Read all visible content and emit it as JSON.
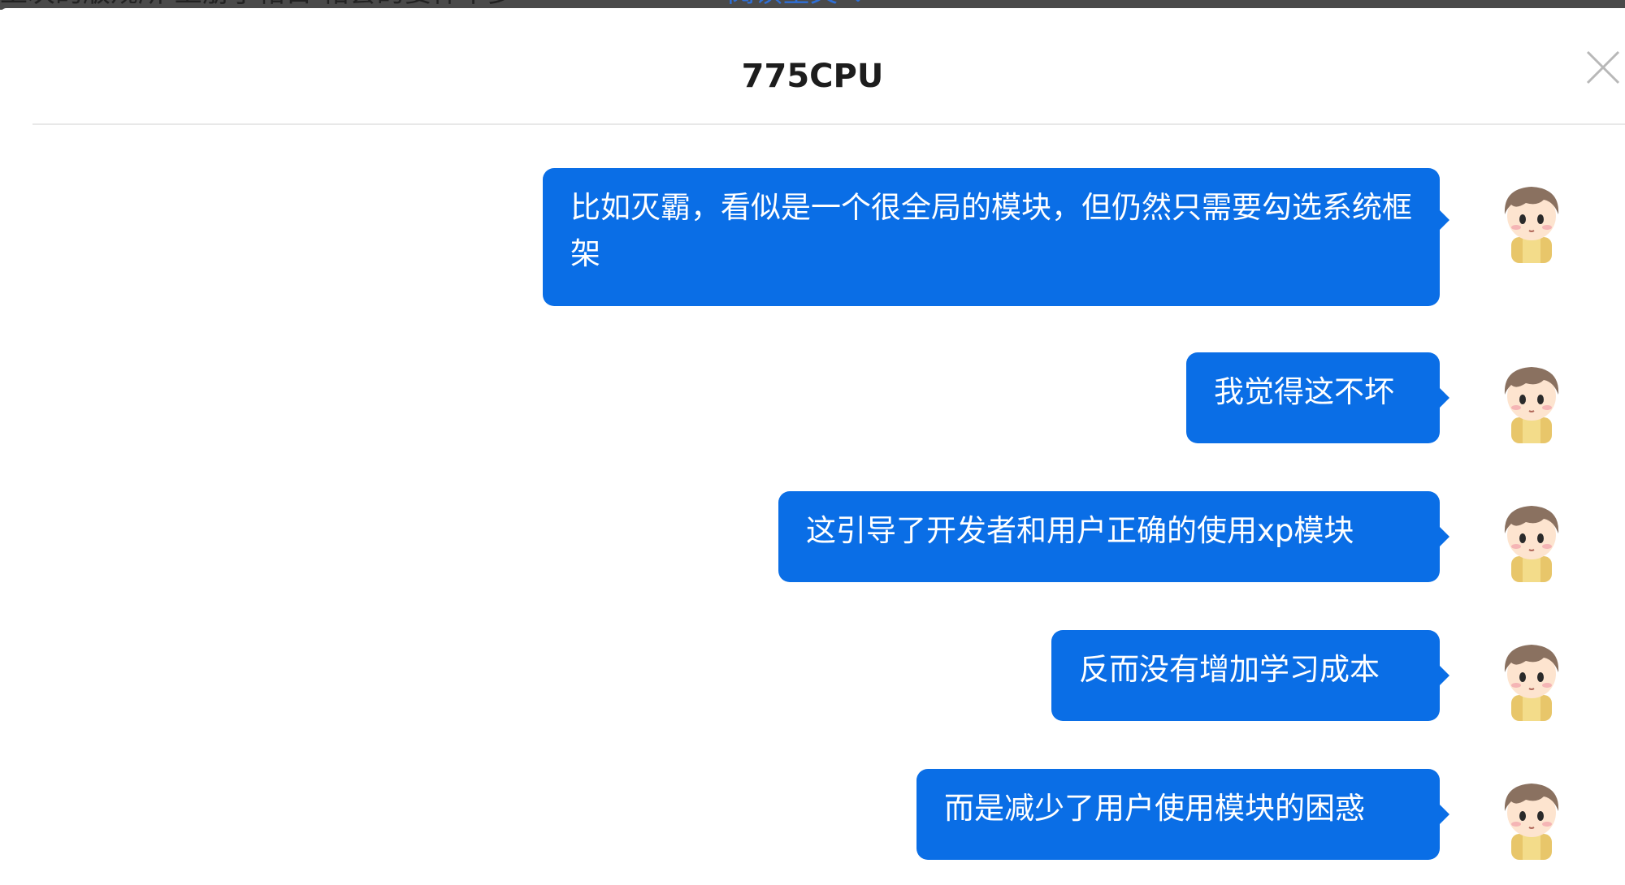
{
  "background": {
    "text": "上次的版规所   上册了帖日   帖套的要件平多",
    "link": "阅读全文 ⌄"
  },
  "dialog": {
    "title": "775CPU",
    "close_icon": "close-icon"
  },
  "colors": {
    "bubble": "#0a6ee6",
    "bubble_text": "#ffffff",
    "title": "#1d1d1d",
    "divider": "#e8e8e8"
  },
  "messages": [
    {
      "text": "比如灭霸，看似是一个很全局的模块，但仍然只需要勾选系统框架",
      "sender": "self"
    },
    {
      "text": "我觉得这不坏",
      "sender": "self"
    },
    {
      "text": "这引导了开发者和用户正确的使用xp模块",
      "sender": "self"
    },
    {
      "text": "反而没有增加学习成本",
      "sender": "self"
    },
    {
      "text": "而是减少了用户使用模块的困惑",
      "sender": "self"
    }
  ]
}
